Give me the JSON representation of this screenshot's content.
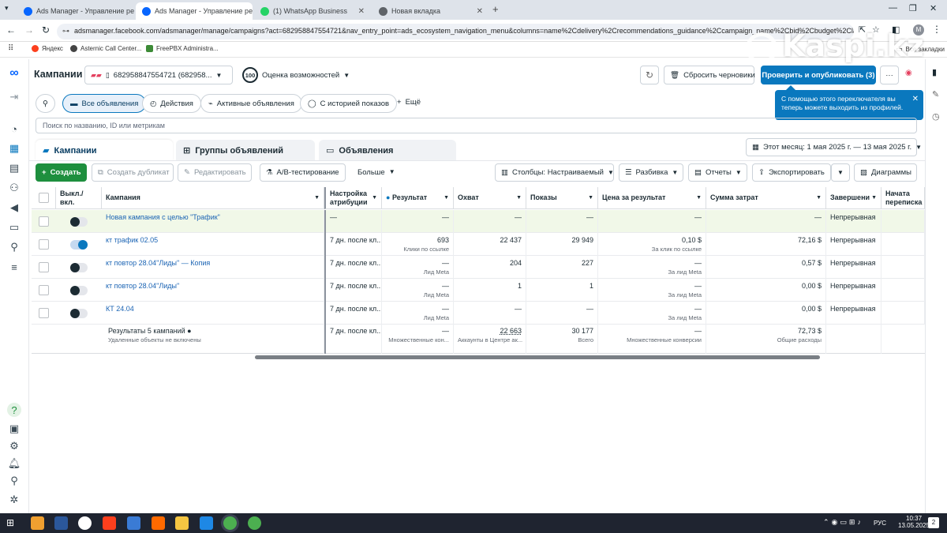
{
  "browser": {
    "tabs": [
      {
        "title": "Ads Manager - Управление ре",
        "active": false
      },
      {
        "title": "Ads Manager - Управление ре",
        "active": true
      },
      {
        "title": "(1) WhatsApp Business",
        "active": false
      },
      {
        "title": "Новая вкладка",
        "active": false
      }
    ],
    "url": "adsmanager.facebook.com/adsmanager/manage/campaigns?act=682958847554721&nav_entry_point=ads_ecosystem_navigation_menu&columns=name%2Cdelivery%2Crecommendations_guidance%2Ccampaign_name%2Cbid%2Cbudget%2Clast_sig...",
    "bookmarks": [
      "Яндекс",
      "Asternic Call Center...",
      "FreePBX Administra..."
    ],
    "all_bookmarks": "Все закладки",
    "avatar_letter": "M"
  },
  "watermark": "Kaspi.kz",
  "header": {
    "title": "Кампании",
    "account": "682958847554721 (682958...",
    "opportunity_score": "100",
    "opportunity_label": "Оценка возможностей",
    "discard_label": "Сбросить черновики",
    "publish_label": "Проверить и опубликовать (3)",
    "more_label": "···"
  },
  "tooltip": "С помощью этого переключателя вы теперь можете выходить из профилей.",
  "filters": [
    "Все объявления",
    "Действия",
    "Активные объявления",
    "С историей показов",
    "Ещё"
  ],
  "search_placeholder": "Поиск по названию, ID или метрикам",
  "level_tabs": [
    "Кампании",
    "Группы объявлений",
    "Объявления"
  ],
  "date_range": "Этот месяц: 1 мая 2025 г. — 13 мая 2025 г.",
  "toolbar": {
    "create": "Создать",
    "duplicate": "Создать дубликат",
    "edit": "Редактировать",
    "ab": "A/B-тестирование",
    "more": "Больше",
    "columns": "Столбцы: Настраиваемый",
    "breakdown": "Разбивка",
    "reports": "Отчеты",
    "export": "Экспортировать",
    "charts": "Диаграммы"
  },
  "table": {
    "headers": [
      "Выкл./ вкл.",
      "Кампания",
      "Настройка атрибуции",
      "Результат",
      "Охват",
      "Показы",
      "Цена за результат",
      "Сумма затрат",
      "Завершени",
      "Начата переписка"
    ],
    "rows": [
      {
        "on": false,
        "name": "Новая кампания с целью \"Трафик\"",
        "attribution": "—",
        "result": "—",
        "result_sub": "",
        "reach": "—",
        "impressions": "—",
        "cpr": "—",
        "cpr_sub": "",
        "spend": "—",
        "end": "Непрерывная",
        "highlight": true
      },
      {
        "on": true,
        "name": "кт трафик 02.05",
        "attribution": "7 дн. после кл...",
        "result": "693",
        "result_sub": "Клики по ссылке",
        "reach": "22 437",
        "impressions": "29 949",
        "cpr": "0,10 $",
        "cpr_sub": "За клик по ссылке",
        "spend": "72,16 $",
        "end": "Непрерывная",
        "highlight": false
      },
      {
        "on": false,
        "name": "кт повтор 28.04\"Лиды\" — Копия",
        "attribution": "7 дн. после кл...",
        "result": "—",
        "result_sub": "Лид Meta",
        "reach": "204",
        "impressions": "227",
        "cpr": "—",
        "cpr_sub": "За лид Meta",
        "spend": "0,57 $",
        "end": "Непрерывная",
        "highlight": false
      },
      {
        "on": false,
        "name": "кт повтор 28.04\"Лиды\"",
        "attribution": "7 дн. после кл...",
        "result": "—",
        "result_sub": "Лид Meta",
        "reach": "1",
        "impressions": "1",
        "cpr": "—",
        "cpr_sub": "За лид Meta",
        "spend": "0,00 $",
        "end": "Непрерывная",
        "highlight": false
      },
      {
        "on": false,
        "name": "КТ 24.04",
        "attribution": "7 дн. после кл...",
        "result": "—",
        "result_sub": "Лид Meta",
        "reach": "—",
        "impressions": "—",
        "cpr": "—",
        "cpr_sub": "За лид Meta",
        "spend": "0,00 $",
        "end": "Непрерывная",
        "highlight": false
      }
    ],
    "total": {
      "name": "Результаты 5 кампаний",
      "name_sub": "Удаленные объекты не включены",
      "attribution": "7 дн. после кл...",
      "result": "—",
      "result_sub": "Множественные кон...",
      "reach": "22 663",
      "reach_sub": "Аккаунты в Центре ак...",
      "impressions": "30 177",
      "impressions_sub": "Всего",
      "cpr": "—",
      "cpr_sub": "Множественные конверсии",
      "spend": "72,73 $",
      "spend_sub": "Общие расходы"
    }
  },
  "taskbar": {
    "lang": "РУС",
    "time": "10:37",
    "date": "13.05.2025",
    "notif": "2"
  }
}
